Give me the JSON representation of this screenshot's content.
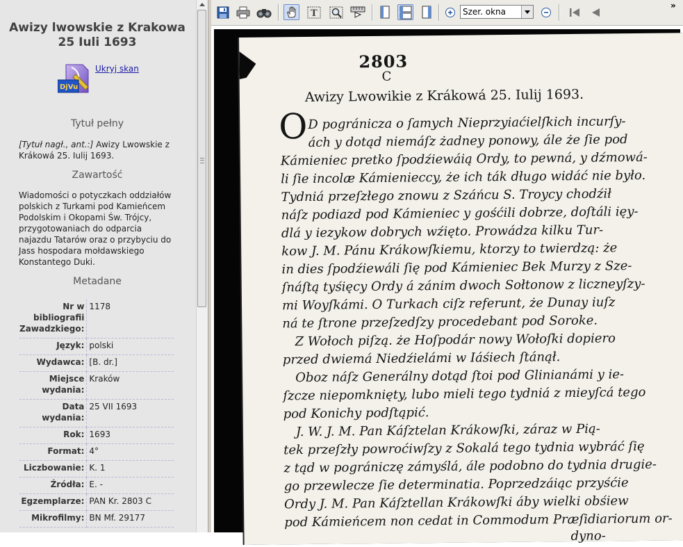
{
  "record": {
    "title": "Awizy lwowskie z Krakowa 25 Iuli 1693",
    "hide_scan_link": "Ukryj skan",
    "djvu_badge": "DjVu",
    "sections": {
      "full_title": "Tytuł pełny",
      "content": "Zawartość",
      "metadata": "Metadane"
    },
    "full_title_prefix": "[Tytuł nagł., ant.:]",
    "full_title_text": " Awizy Lwowskie z Krákowá 25. Iulij 1693.",
    "content_text": "Wiadomości o potyczkach oddziałów polskich z Turkami pod Kamieńcem Podolskim i Okopami Św. Trójcy, przygotowaniach do odparcia najazdu Tatarów oraz o przybyciu do Jass hospodara mołdawskiego Konstantego Duki.",
    "metadata": [
      {
        "key": "Nr w bibliografii Zawadzkiego:",
        "value": "1178"
      },
      {
        "key": "Język:",
        "value": "polski"
      },
      {
        "key": "Wydawca:",
        "value": "[B. dr.]"
      },
      {
        "key": "Miejsce wydania:",
        "value": "Kraków"
      },
      {
        "key": "Data wydania:",
        "value": "25 VII 1693"
      },
      {
        "key": "Rok:",
        "value": "1693"
      },
      {
        "key": "Format:",
        "value": "4°"
      },
      {
        "key": "Liczbowanie:",
        "value": "K. 1"
      },
      {
        "key": "Źródła:",
        "value": "E. -"
      },
      {
        "key": "Egzemplarze:",
        "value": "PAN Kr. 2803 C"
      },
      {
        "key": "Mikrofilmy:",
        "value": "BN Mf. 29177"
      }
    ]
  },
  "viewer": {
    "zoom_value": "Szer. okna",
    "more_label": "»",
    "icons": [
      "save-icon",
      "print-icon",
      "find-icon",
      "hand-icon",
      "text-select-icon",
      "zoom-rect-icon",
      "ruler-icon",
      "single-page-icon",
      "continuous-icon",
      "facing-icon",
      "zoom-in-icon",
      "zoom-out-icon",
      "first-page-icon",
      "prev-page-icon"
    ]
  },
  "scan": {
    "shelf_number": "2803",
    "shelf_letter": "C",
    "heading": "Awizy Lwowikie z Krákowá 25. Iulij 1693.",
    "drop_cap": "O",
    "lines": [
      "D pogránicza o ſamych Nieprzyiaćielſkich incurſy-",
      "ách y dotąd niemáſz żadney ponowy, ále że ſie pod",
      "Kámieniec pretko ſpodźiewáią Ordy, to pewná, y dźmowá-",
      "li ſie incolæ Kámienieccy, że ich ták długo widáć nie było.",
      "Tydniá przeſzłego znowu z Száńcu S. Troycy chodźił",
      "náſz podiazd pod Kámieniec y gośćili dobrze, doſtáli ięy-",
      "dlá y iezykow dobrych wźięto. Prowádza kilku Tur-",
      "kow J. M. Pánu Krákowſkiemu, ktorzy to twierdzą: że",
      "in dies ſpodźiewáli ſię pod Kámieniec Bek Murzy z Sze-",
      "ſnáſtą tyśięcy Ordy á zánim dwoch Sołtonow z liczneyſzy-",
      "mi Woyſkámi. O Turkach ciſz referunt, że Dunay iuſz",
      "ná te ſtrone przeſzedſzy procedebant pod Soroke.",
      "Z Wołoch piſzą. że Hoſpodár nowy Wołoſki dopiero",
      "przed dwiemá Niedźielámi w Iáśiech ſtánął.",
      "Oboz náſz Generálny dotąd ſtoi pod Glinianámi y ie-",
      "ſzcze niepomknięty, lubo mieli tego tydniá z mieyſcá tego",
      "pod Konichy podſtąpić.",
      "J. W. J. M. Pan Káſztelan Krákowſki, záraz w Pią-",
      "tek przeſzły powroćiwſzy z Sokalá tego tydnia wybráć ſię",
      "z tąd w pográniczę zámyślá, ále podobno do tydnia drugie-",
      "go przewlecze ſie determinatia. Poprzedzáiąc przyśćie",
      "Ordy J. M. Pan Káſztellan Krákowſki áby wielki obśiew",
      "pod Kámieńcem non cedat in Commodum Præſidiariorum or-",
      "dyno-"
    ]
  }
}
